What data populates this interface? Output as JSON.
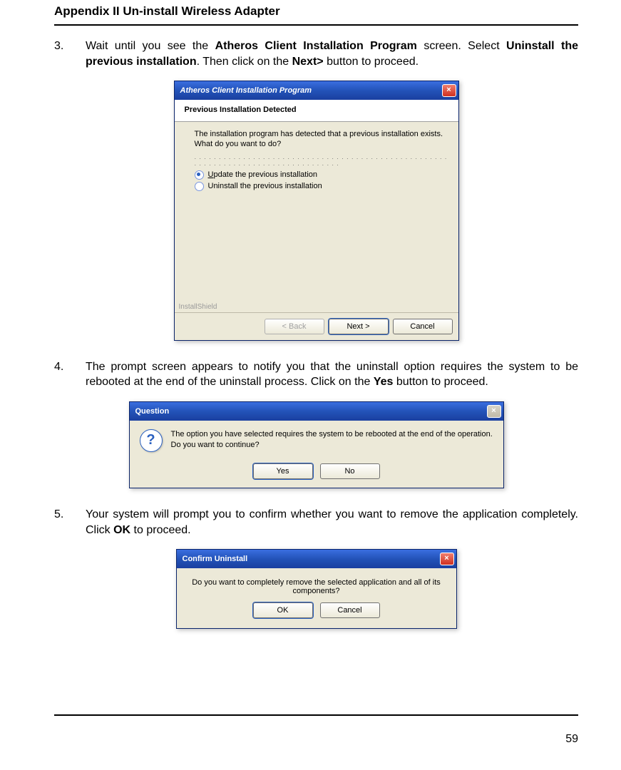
{
  "header": "Appendix II    Un-install Wireless Adapter",
  "page_number": "59",
  "steps": {
    "s3": {
      "num": "3.",
      "pre": "Wait until you see the ",
      "b1": "Atheros Client Installation Program",
      "mid1": " screen. Select ",
      "b2": "Uninstall the previous installation",
      "mid2": ". Then click on the ",
      "b3": "Next>",
      "post": " button to proceed."
    },
    "s4": {
      "num": "4.",
      "pre": "The prompt screen appears to notify you that the uninstall option requires the system to be rebooted at the end of the uninstall process. Click on the ",
      "b1": "Yes",
      "post": " button to proceed."
    },
    "s5": {
      "num": "5.",
      "pre": "Your system will prompt you to confirm whether you want to remove the application completely. Click ",
      "b1": "OK",
      "post": " to proceed."
    }
  },
  "dlg1": {
    "title": "Atheros Client Installation Program",
    "subtitle": "Previous Installation Detected",
    "question": "The installation program has detected that a previous installation exists.  What do you want to do?",
    "opt1_u": "U",
    "opt1_rest": "pdate the previous installation",
    "opt2": "Uninstall the previous installation",
    "installshield": "InstallShield",
    "btn_back": "< Back",
    "btn_next": "Next >",
    "btn_cancel": "Cancel"
  },
  "dlg2": {
    "title": "Question",
    "text": "The option you have selected requires the system to be rebooted at the end of the operation. Do you want to continue?",
    "btn_yes": "Yes",
    "btn_no": "No"
  },
  "dlg3": {
    "title": "Confirm Uninstall",
    "text": "Do you want to completely remove the selected application and all of its components?",
    "btn_ok": "OK",
    "btn_cancel": "Cancel"
  }
}
